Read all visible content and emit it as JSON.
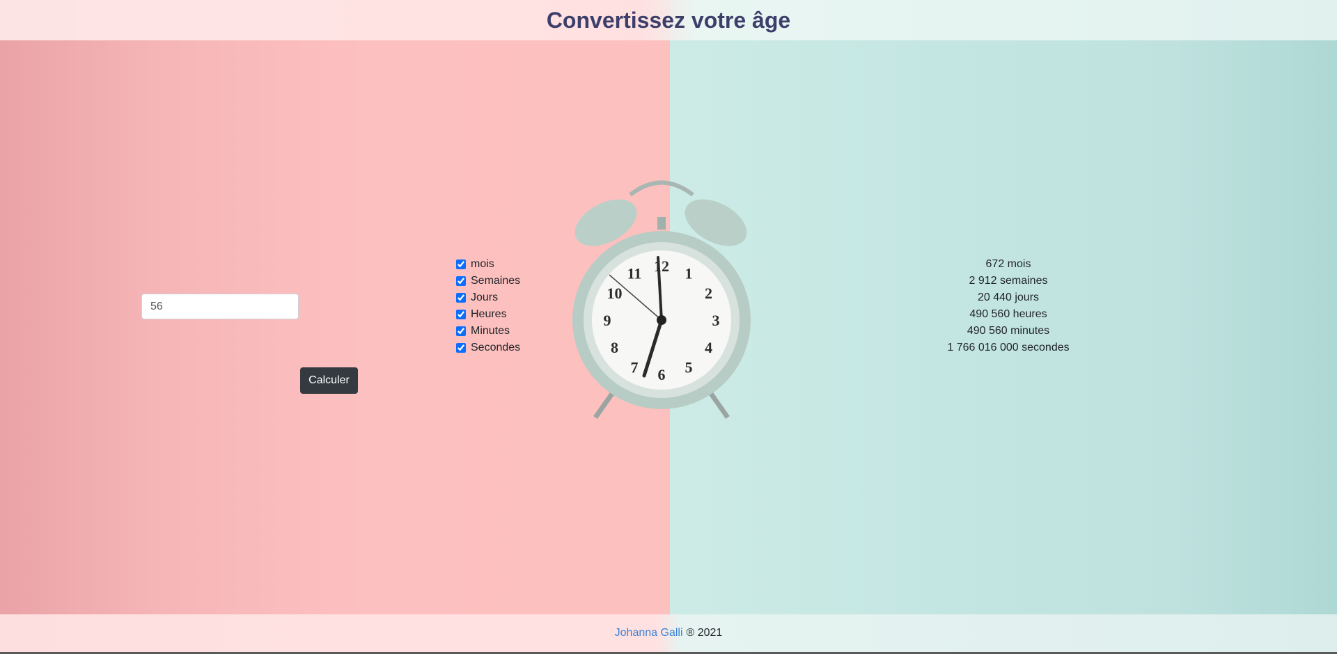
{
  "header": {
    "title": "Convertissez votre âge"
  },
  "form": {
    "age_value": "56",
    "calculate_label": "Calculer",
    "checkboxes": [
      {
        "label": "mois",
        "checked": true
      },
      {
        "label": "Semaines",
        "checked": true
      },
      {
        "label": "Jours",
        "checked": true
      },
      {
        "label": "Heures",
        "checked": true
      },
      {
        "label": "Minutes",
        "checked": true
      },
      {
        "label": "Secondes",
        "checked": true
      }
    ]
  },
  "results": [
    "672 mois",
    "2 912 semaines",
    "20 440 jours",
    "490 560 heures",
    "490 560 minutes",
    "1 766 016 000 secondes"
  ],
  "clock_numerals": [
    "12",
    "1",
    "2",
    "3",
    "4",
    "5",
    "6",
    "7",
    "8",
    "9",
    "10",
    "11"
  ],
  "footer": {
    "author": "Johanna Galli",
    "rest": "® 2021"
  },
  "colors": {
    "title": "#3d3f6b",
    "button": "#343a40",
    "link": "#3a82d8",
    "left_bg": "#fcc0be",
    "right_bg": "#c4e6e2"
  }
}
